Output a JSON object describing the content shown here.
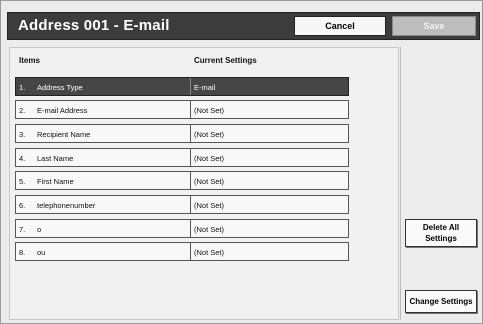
{
  "header": {
    "title": "Address 001 - E-mail",
    "cancel_label": "Cancel",
    "save_label": "Save"
  },
  "columns": {
    "items": "Items",
    "current": "Current Settings"
  },
  "rows": [
    {
      "num": "1.",
      "name": "Address Type",
      "value": "E-mail"
    },
    {
      "num": "2.",
      "name": "E-mail Address",
      "value": "(Not Set)"
    },
    {
      "num": "3.",
      "name": "Recipient Name",
      "value": "(Not Set)"
    },
    {
      "num": "4.",
      "name": "Last Name",
      "value": "(Not Set)"
    },
    {
      "num": "5.",
      "name": "First Name",
      "value": "(Not Set)"
    },
    {
      "num": "6.",
      "name": "telephonenumber",
      "value": "(Not Set)"
    },
    {
      "num": "7.",
      "name": "o",
      "value": "(Not Set)"
    },
    {
      "num": "8.",
      "name": "ou",
      "value": "(Not Set)"
    }
  ],
  "side": {
    "delete_all_line1": "Delete All",
    "delete_all_line2": "Settings",
    "change_settings": "Change Settings"
  }
}
